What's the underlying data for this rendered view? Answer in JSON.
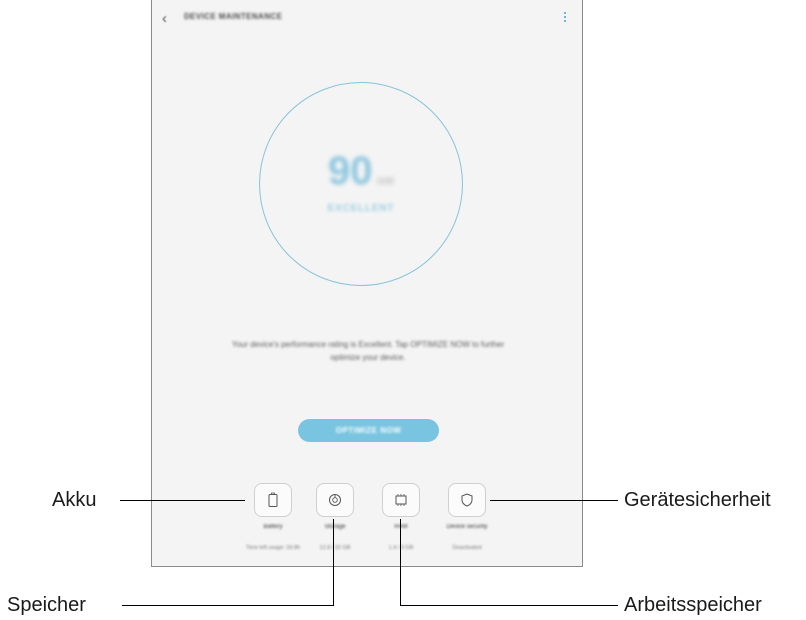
{
  "header": {
    "back_icon": "back-arrow-icon",
    "title": "DEVICE MAINTENANCE",
    "more_icon": "more-vertical-icon"
  },
  "score": {
    "value": "90",
    "unit": "/100",
    "status": "EXCELLENT",
    "ring_color": "#86c4dc"
  },
  "message": "Your device's performance rating is Excellent. Tap OPTIMIZE NOW to further optimize your device.",
  "optimize_button": {
    "label": "OPTIMIZE NOW",
    "color": "#79c4e0"
  },
  "tiles": [
    {
      "icon": "battery-icon",
      "label": "Battery",
      "value": "Time left usage: 2d 8h"
    },
    {
      "icon": "storage-icon",
      "label": "Storage",
      "value": "12.8 / 32 GB"
    },
    {
      "icon": "memory-chip-icon",
      "label": "RAM",
      "value": "1.4 / 3 GB"
    },
    {
      "icon": "shield-icon",
      "label": "Device security",
      "value": "Deactivated"
    }
  ],
  "callouts": {
    "battery": "Akku",
    "storage": "Speicher",
    "memory": "Arbeitsspeicher",
    "security": "Gerätesicherheit"
  }
}
